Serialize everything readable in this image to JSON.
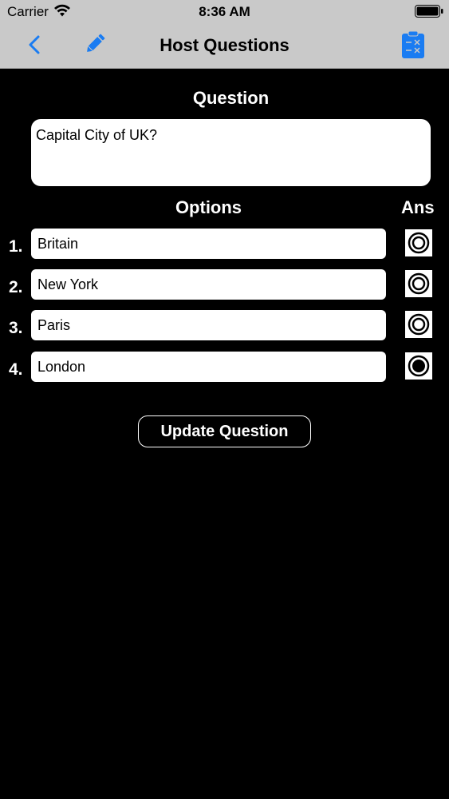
{
  "status_bar": {
    "carrier": "Carrier",
    "time": "8:36 AM",
    "wifi_icon": "wifi-icon",
    "battery_icon": "battery-full-icon"
  },
  "nav_bar": {
    "title": "Host Questions",
    "back_icon": "chevron-left-icon",
    "edit_icon": "pencil-icon",
    "right_icon": "clipboard-icon",
    "accent_color": "#1a7cf2"
  },
  "question": {
    "label": "Question",
    "text": "Capital City of UK?"
  },
  "options": {
    "label": "Options",
    "ans_label": "Ans",
    "items": [
      {
        "number": "1.",
        "value": "Britain",
        "selected": false
      },
      {
        "number": "2.",
        "value": "New York",
        "selected": false
      },
      {
        "number": "3.",
        "value": "Paris",
        "selected": false
      },
      {
        "number": "4.",
        "value": "London",
        "selected": true
      }
    ]
  },
  "update_button": {
    "label": "Update Question"
  }
}
